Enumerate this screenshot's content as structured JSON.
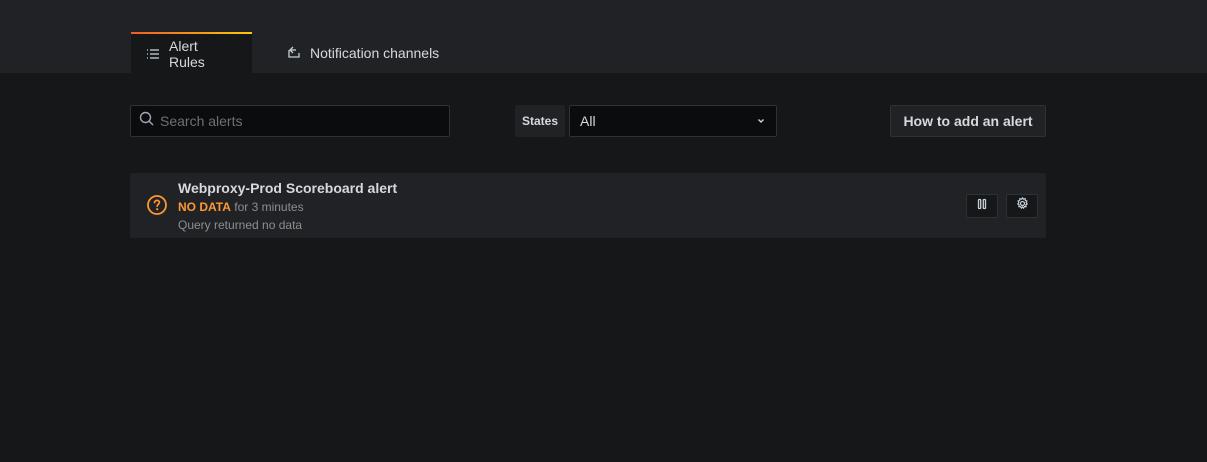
{
  "tabs": [
    {
      "label": "Alert Rules",
      "icon": "list-icon",
      "active": true
    },
    {
      "label": "Notification channels",
      "icon": "comment-alt-share-icon",
      "active": false
    }
  ],
  "search": {
    "placeholder": "Search alerts",
    "value": ""
  },
  "states_filter": {
    "label": "States",
    "selected": "All"
  },
  "help_button": {
    "label": "How to add an alert"
  },
  "alerts": [
    {
      "name": "Webproxy-Prod Scoreboard alert",
      "state": "NO DATA",
      "duration": "for 3 minutes",
      "info": "Query returned no data",
      "state_color": "#ff9830"
    }
  ],
  "colors": {
    "background": "#161719",
    "panel": "#202226",
    "accent_gradient_start": "#f05a28",
    "accent_gradient_end": "#fbca0a",
    "warning": "#ff9830"
  }
}
